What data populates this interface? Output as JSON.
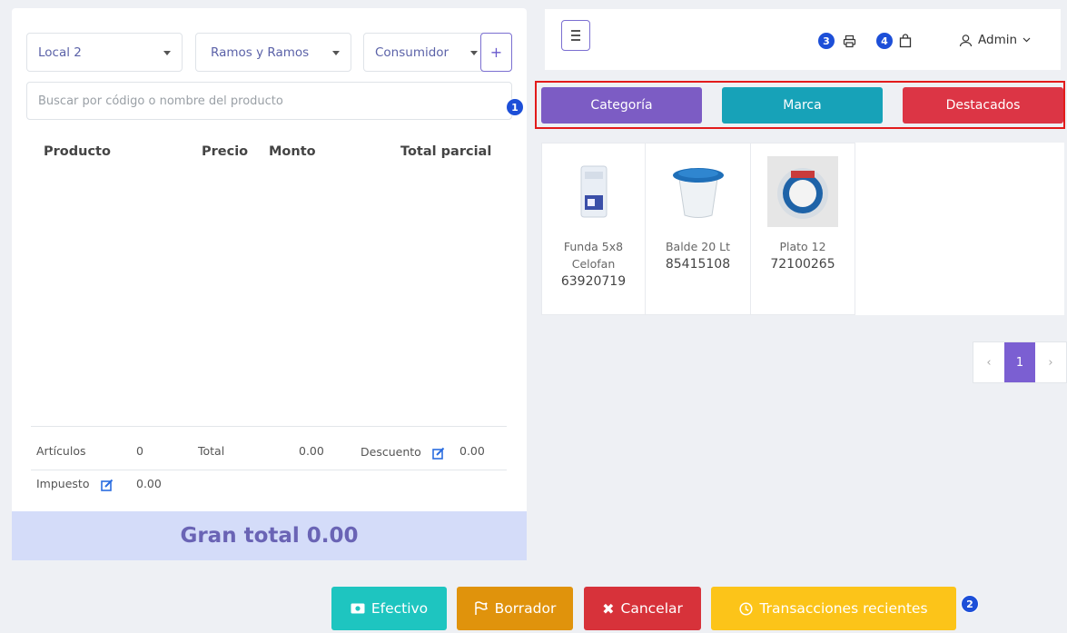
{
  "cart": {
    "local_select": "Local 2",
    "customer_group_select": "Ramos y Ramos",
    "customer_select": "Consumidor",
    "add_button_label": "+",
    "search_placeholder": "Buscar por código o nombre del producto",
    "columns": [
      "Producto",
      "Precio",
      "Monto",
      "Total parcial"
    ],
    "summary": {
      "items_label": "Artículos",
      "items_value": "0",
      "total_label": "Total",
      "total_value": "0.00",
      "discount_label": "Descuento",
      "discount_value": "0.00",
      "tax_label": "Impuesto",
      "tax_value": "0.00"
    },
    "grand_total": "Gran total 0.00"
  },
  "header": {
    "user_name": "Admin",
    "badges": {
      "print": "3",
      "bag": "4"
    }
  },
  "annotations": {
    "tabs_marker": "1",
    "actions_marker": "2"
  },
  "tabs": [
    "Categoría",
    "Marca",
    "Destacados"
  ],
  "products": [
    {
      "name": "Funda 5x8 Celofan",
      "code": "63920719"
    },
    {
      "name": "Balde 20 Lt",
      "code": "85415108"
    },
    {
      "name": "Plato 12",
      "code": "72100265"
    }
  ],
  "pagination": {
    "prev": "‹",
    "current": "1",
    "next": "›"
  },
  "actions": {
    "cash": "Efectivo",
    "draft": "Borrador",
    "cancel": "Cancelar",
    "recent": "Transacciones recientes"
  },
  "colors": {
    "category": "#7c5cc4",
    "brand": "#17a2b8",
    "featured": "#dc3545",
    "cash": "#1ec5c0",
    "draft": "#e0930c",
    "cancel": "#d7323a",
    "recent": "#fcc419"
  }
}
